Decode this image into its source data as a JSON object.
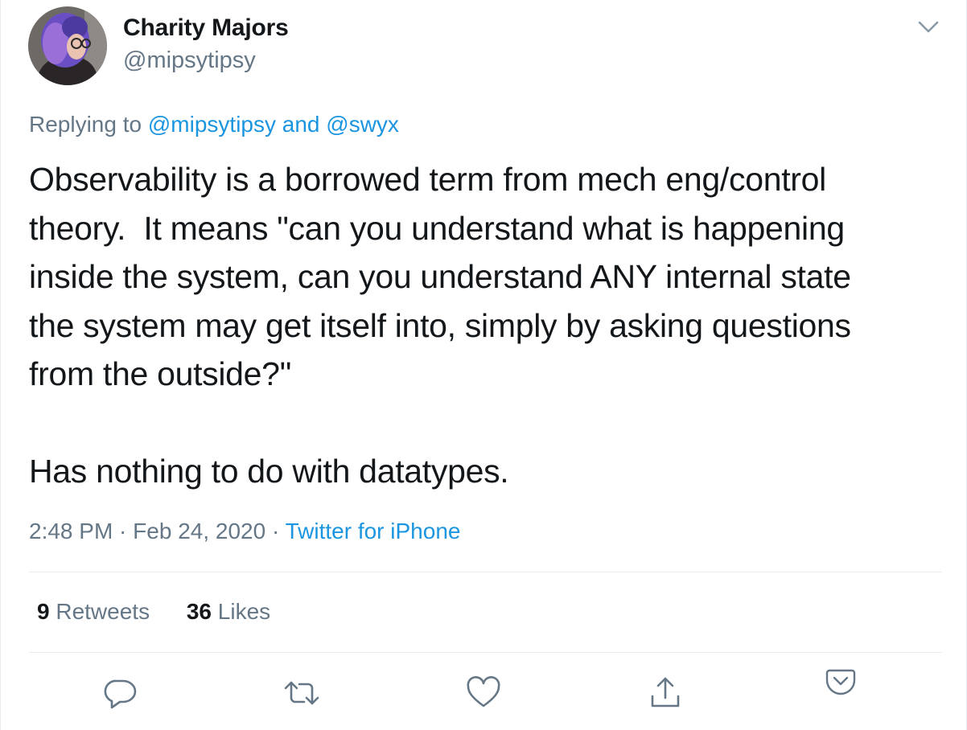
{
  "author": {
    "name": "Charity Majors",
    "handle": "@mipsytipsy",
    "avatar_icon": "profile-photo"
  },
  "reply": {
    "prefix": "Replying to ",
    "mention1": "@mipsytipsy",
    "conjunction": " and ",
    "mention2": "@swyx"
  },
  "tweet": {
    "text": "Observability is a borrowed term from mech eng/control\ntheory.  It means \"can you understand what is happening\ninside the system, can you understand ANY internal state\nthe system may get itself into, simply by asking questions\nfrom the outside?\"\n\nHas nothing to do with datatypes."
  },
  "meta": {
    "time": "2:48 PM",
    "separator": " · ",
    "date": "Feb 24, 2020",
    "source": "Twitter for iPhone"
  },
  "stats": {
    "retweets_count": "9",
    "retweets_label": " Retweets",
    "likes_count": "36",
    "likes_label": " Likes"
  },
  "actions": [
    "reply-icon",
    "retweet-icon",
    "like-icon",
    "share-icon",
    "pocket-icon"
  ],
  "colors": {
    "link": "#1b95e0",
    "secondary_text": "#657786",
    "primary_text": "#14171a",
    "divider": "#e6ecf0"
  }
}
